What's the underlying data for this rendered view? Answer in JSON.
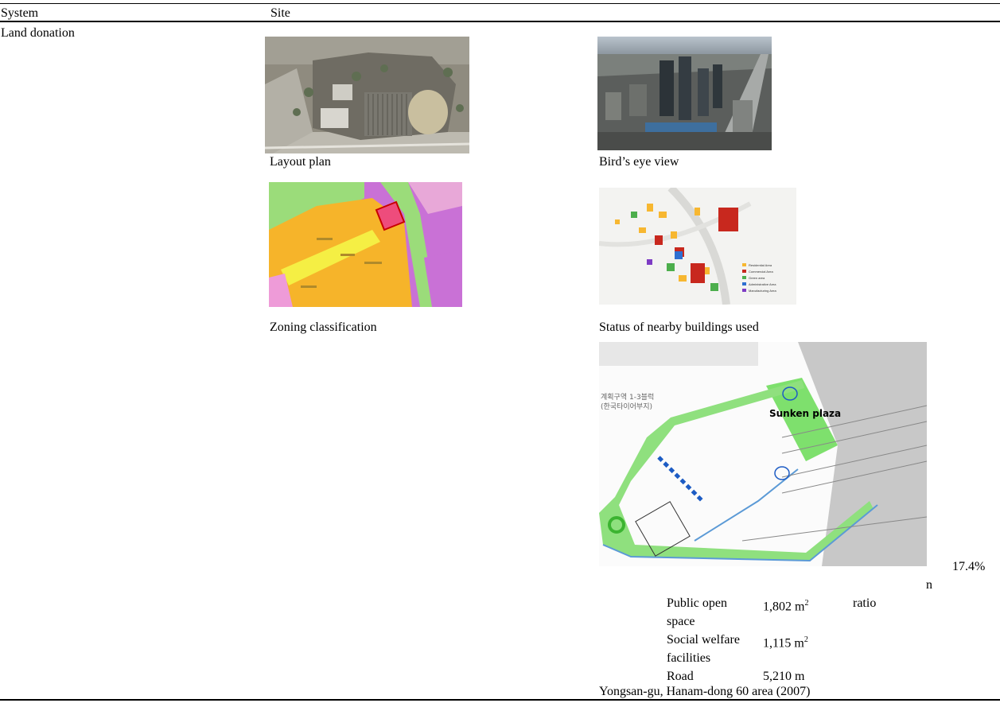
{
  "table": {
    "col_system": "System",
    "col_site": "Site",
    "row_system": "Land donation"
  },
  "images": [
    {
      "caption": "Layout plan"
    },
    {
      "caption": "Bird’s eye view"
    },
    {
      "caption": "Zoning classification"
    },
    {
      "caption": "Status of nearby buildings used"
    }
  ],
  "site_plan": {
    "label": "Sunken plaza",
    "legend": [
      "Residential Area",
      "Commercial Area",
      "Green area",
      "Administrative Area",
      "Manufacturing Area"
    ]
  },
  "donation_table": {
    "rows": [
      {
        "item_line1": "Public open",
        "item_line2": "space",
        "value": "1,802 m",
        "sup": "2"
      },
      {
        "item_line1": "Social welfare",
        "item_line2": "facilities",
        "value": "1,115 m",
        "sup": "2"
      },
      {
        "item_line1": "Road",
        "item_line2": "",
        "value": "5,210 m",
        "sup": ""
      }
    ],
    "ratio_label": "ratio",
    "ratio_value": "17.4%",
    "stray_char": "n"
  },
  "location": "Yongsan-gu, Hanam-dong 60 area (2007)"
}
